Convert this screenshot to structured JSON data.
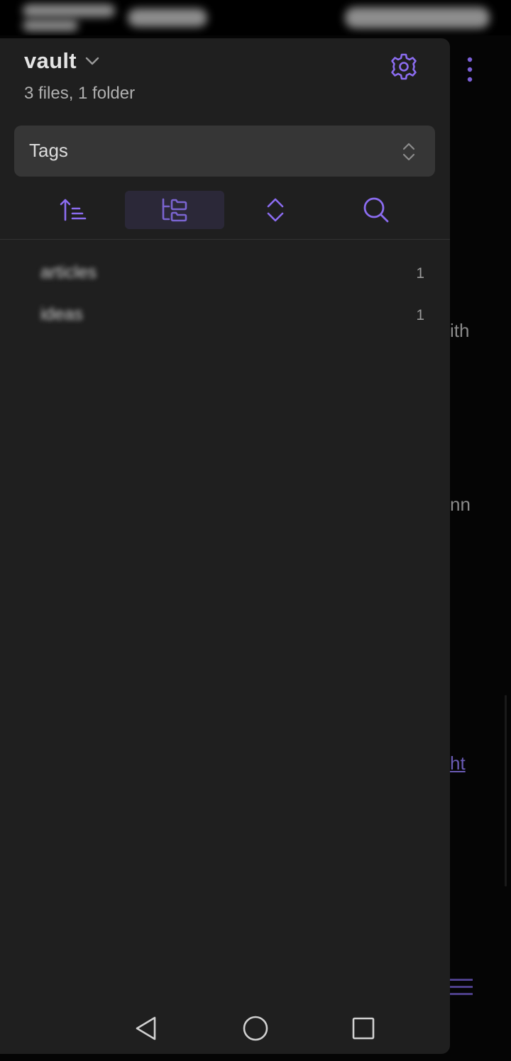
{
  "status_bar": {},
  "background_note": {
    "text_fragments": [
      "ith",
      "nn"
    ],
    "link_fragment": "ht"
  },
  "drawer": {
    "vault": {
      "name": "vault",
      "stats": "3 files, 1 folder"
    },
    "view_selector": {
      "selected": "Tags"
    },
    "toolbar": {
      "buttons": [
        {
          "icon": "sort-ascending-icon",
          "active": false
        },
        {
          "icon": "folder-tree-icon",
          "active": true
        },
        {
          "icon": "expand-collapse-icon",
          "active": false
        },
        {
          "icon": "search-icon",
          "active": false
        }
      ]
    },
    "tags": [
      {
        "name": "articles",
        "count": "1"
      },
      {
        "name": "ideas",
        "count": "1"
      }
    ]
  },
  "navigation": {
    "buttons": [
      "back-icon",
      "home-icon",
      "recents-icon"
    ]
  },
  "colors": {
    "accent": "#8b6cf0",
    "drawer_bg": "#1f1f1f",
    "select_bg": "#363636",
    "active_tool_bg": "#2b2838"
  }
}
